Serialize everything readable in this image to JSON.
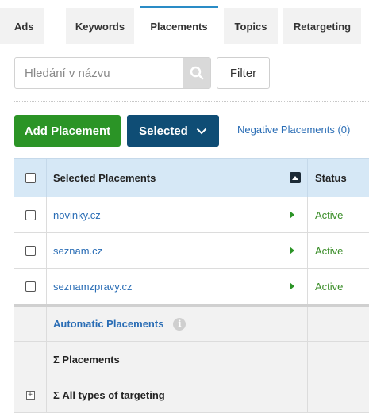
{
  "tabs": [
    {
      "label": "Ads",
      "active": false
    },
    {
      "label": "Keywords",
      "active": false
    },
    {
      "label": "Placements",
      "active": true
    },
    {
      "label": "Topics",
      "active": false
    },
    {
      "label": "Retargeting",
      "active": false
    }
  ],
  "search": {
    "placeholder": "Hledání v názvu",
    "value": "",
    "icon": "search-icon"
  },
  "filter": {
    "label": "Filter"
  },
  "actions": {
    "add_label": "Add Placement",
    "selected_label": "Selected",
    "negative_link": "Negative Placements (0)"
  },
  "table": {
    "headers": {
      "name": "Selected Placements",
      "status": "Status"
    },
    "rows": [
      {
        "name": "novinky.cz",
        "status": "Active"
      },
      {
        "name": "seznam.cz",
        "status": "Active"
      },
      {
        "name": "seznamzpravy.cz",
        "status": "Active"
      }
    ],
    "summary": {
      "automatic": "Automatic Placements",
      "placements_total": "Σ Placements",
      "all_targeting": "Σ All types of targeting"
    }
  },
  "colors": {
    "accent_blue": "#2a8cc6",
    "add_green": "#2b9426",
    "selected_navy": "#0f4d75",
    "link_blue": "#2a6db5",
    "active_green": "#3a8d28",
    "header_bg": "#d6e8f6"
  }
}
